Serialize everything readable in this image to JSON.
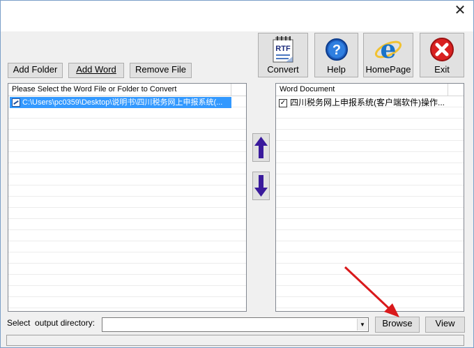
{
  "window": {
    "close_glyph": "✕"
  },
  "toolbar": {
    "add_folder": "Add Folder",
    "add_word": "Add Word",
    "remove_file": "Remove File",
    "convert": {
      "label": "Convert",
      "icon": "rtf-icon",
      "icon_text": "RTF"
    },
    "help": {
      "label": "Help",
      "icon": "help-icon",
      "icon_text": "?"
    },
    "homepage": {
      "label": "HomePage",
      "icon": "ie-icon"
    },
    "exit": {
      "label": "Exit",
      "icon": "exit-icon"
    }
  },
  "source_list": {
    "header": "Please Select the Word File or Folder to Convert",
    "items": [
      {
        "path": "C:\\Users\\pc0359\\Desktop\\说明书\\四川税务网上申报系统(...",
        "selected": true
      }
    ]
  },
  "word_list": {
    "header": "Word Document",
    "items": [
      {
        "name": "四川税务网上申报系统(客户端软件)操作...",
        "checked": true
      }
    ]
  },
  "arrows": {
    "up": "move-up-icon",
    "down": "move-down-icon"
  },
  "output": {
    "label": "Select  output directory:",
    "value": "",
    "browse": "Browse",
    "view": "View"
  },
  "colors": {
    "selection": "#3399ff",
    "arrow_purple": "#3a1a9c",
    "annotation_red": "#d9191b",
    "exit_red": "#d92121"
  }
}
